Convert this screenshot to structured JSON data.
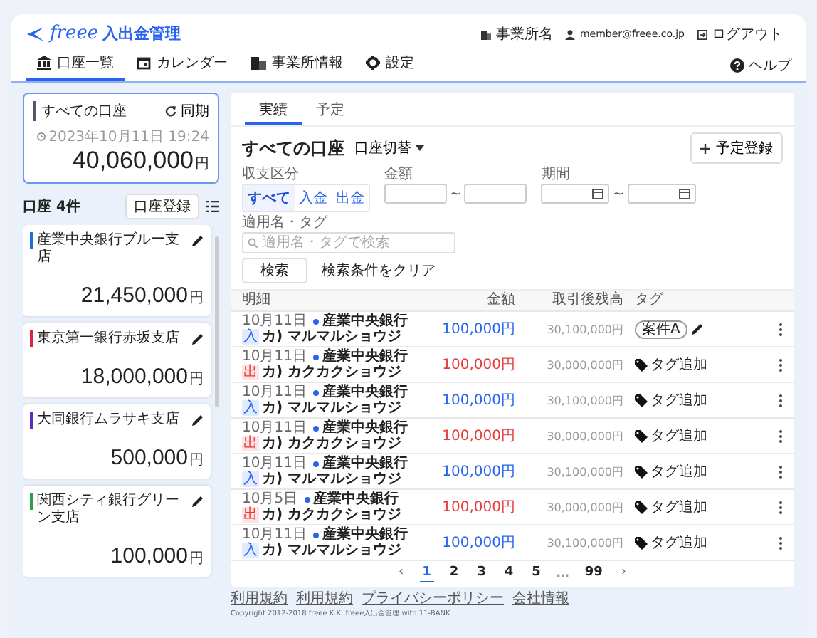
{
  "app": {
    "logo_text": "freee",
    "title": "入出金管理"
  },
  "user_menu": {
    "office": "事業所名",
    "email": "member@freee.co.jp",
    "logout": "ログアウト"
  },
  "nav": {
    "items": [
      {
        "label": "口座一覧",
        "kind": "bank",
        "selected": true
      },
      {
        "label": "カレンダー",
        "kind": "calendar",
        "selected": false
      },
      {
        "label": "事業所情報",
        "kind": "building",
        "selected": false
      },
      {
        "label": "設定",
        "kind": "gear",
        "selected": false
      }
    ],
    "help": "ヘルプ"
  },
  "summary": {
    "title": "すべての口座",
    "sync": "同期",
    "updated": "2023年10月11日 19:24",
    "amount": "40,060,000",
    "unit": "円"
  },
  "accounts": {
    "heading": "口座 4件",
    "register": "口座登録",
    "items": [
      {
        "name": "産業中央銀行ブルー支店",
        "color": "#1f6fd6",
        "amount": "21,450,000",
        "unit": "円"
      },
      {
        "name": "東京第一銀行赤坂支店",
        "color": "#d7263d",
        "amount": "18,000,000",
        "unit": "円"
      },
      {
        "name": "大同銀行ムラサキ支店",
        "color": "#5b2fc4",
        "amount": "500,000",
        "unit": "円"
      },
      {
        "name": "関西シティ銀行グリーン支店",
        "color": "#2e9c4b",
        "amount": "100,000",
        "unit": "円"
      }
    ]
  },
  "tabs": [
    {
      "label": "実績",
      "selected": true
    },
    {
      "label": "予定",
      "selected": false
    }
  ],
  "header": {
    "title": "すべての口座",
    "switch": "口座切替",
    "add": "予定登録"
  },
  "filters": {
    "type_label": "収支区分",
    "types": [
      {
        "label": "すべて",
        "selected": true
      },
      {
        "label": "入金",
        "selected": false
      },
      {
        "label": "出金",
        "selected": false
      }
    ],
    "amount_label": "金額",
    "range_sep": "~",
    "period_label": "期間",
    "period_sep": "~",
    "tag_label": "適用名・タグ",
    "tag_placeholder": "適用名・タグで検索",
    "search": "検索",
    "clear": "検索条件をクリア"
  },
  "table": {
    "columns": [
      "明細",
      "金額",
      "取引後残高",
      "タグ"
    ],
    "rows": [
      {
        "date": "10月11日",
        "bank": "産業中央銀行",
        "kind": "in",
        "badge": "入",
        "name": "カ) マルマルショウジ",
        "amount": "100,000円",
        "balance": "30,100,000円",
        "tag": "案件A"
      },
      {
        "date": "10月11日",
        "bank": "産業中央銀行",
        "kind": "out",
        "badge": "出",
        "name": "カ) カクカクショウジ",
        "amount": "100,000円",
        "balance": "30,000,000円",
        "tag_action": "タグ追加"
      },
      {
        "date": "10月11日",
        "bank": "産業中央銀行",
        "kind": "in",
        "badge": "入",
        "name": "カ) マルマルショウジ",
        "amount": "100,000円",
        "balance": "30,100,000円",
        "tag_action": "タグ追加"
      },
      {
        "date": "10月11日",
        "bank": "産業中央銀行",
        "kind": "out",
        "badge": "出",
        "name": "カ) カクカクショウジ",
        "amount": "100,000円",
        "balance": "30,000,000円",
        "tag_action": "タグ追加"
      },
      {
        "date": "10月11日",
        "bank": "産業中央銀行",
        "kind": "in",
        "badge": "入",
        "name": "カ) マルマルショウジ",
        "amount": "100,000円",
        "balance": "30,100,000円",
        "tag_action": "タグ追加"
      },
      {
        "date": "10月5日",
        "bank": "産業中央銀行",
        "kind": "out",
        "badge": "出",
        "name": "カ) カクカクショウジ",
        "amount": "100,000円",
        "balance": "30,000,000円",
        "tag_action": "タグ追加"
      },
      {
        "date": "10月11日",
        "bank": "産業中央銀行",
        "kind": "in",
        "badge": "入",
        "name": "カ) マルマルショウジ",
        "amount": "100,000円",
        "balance": "30,100,000円",
        "tag_action": "タグ追加"
      }
    ]
  },
  "pagination": {
    "prev": "‹",
    "next": "›",
    "pages": [
      {
        "label": "1",
        "selected": true
      },
      {
        "label": "2",
        "selected": false
      },
      {
        "label": "3",
        "selected": false
      },
      {
        "label": "4",
        "selected": false
      },
      {
        "label": "5",
        "selected": false
      }
    ],
    "ellipsis": "…",
    "last": "99"
  },
  "footer": {
    "links": [
      "利用規約",
      "利用規約",
      "プライバシーポリシー",
      "会社情報"
    ],
    "copyright": "Copyright 2012-2018 freee K.K.   freee入出金管理 with 11-BANK"
  }
}
